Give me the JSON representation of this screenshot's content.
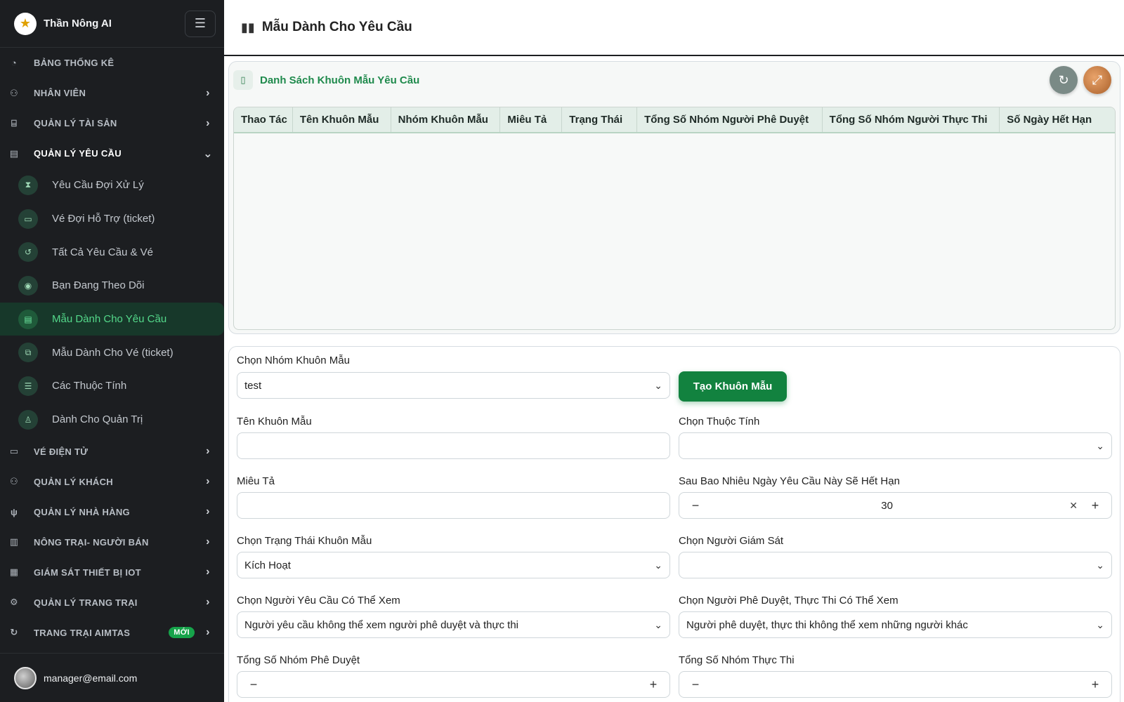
{
  "sidebar": {
    "brand_name": "Thần Nông AI",
    "items": [
      {
        "label": "BẢNG THỐNG KÊ",
        "icon": "dashboard-icon",
        "glyph": "◔"
      },
      {
        "label": "NHÂN VIÊN",
        "icon": "employees-icon",
        "glyph": "⚇"
      },
      {
        "label": "QUẢN LÝ TÀI SẢN",
        "icon": "assets-icon",
        "glyph": "⌸"
      },
      {
        "label": "QUẢN LÝ YÊU CẦU",
        "icon": "clipboard-icon",
        "glyph": "▤"
      },
      {
        "label": "VÉ ĐIỆN TỬ",
        "icon": "ticket-icon",
        "glyph": "▭"
      },
      {
        "label": "QUẢN LÝ KHÁCH",
        "icon": "guests-icon",
        "glyph": "⚇"
      },
      {
        "label": "QUẢN LÝ NHÀ HÀNG",
        "icon": "restaurant-icon",
        "glyph": "ψ"
      },
      {
        "label": "NÔNG TRẠI- NGƯỜI BÁN",
        "icon": "store-icon",
        "glyph": "▥"
      },
      {
        "label": "GIÁM SÁT THIẾT BỊ IOT",
        "icon": "iot-chart-icon",
        "glyph": "▦"
      },
      {
        "label": "QUẢN LÝ TRANG TRẠI",
        "icon": "farm-icon",
        "glyph": "⚙"
      },
      {
        "label": "TRANG TRẠI AIMTAS",
        "icon": "aimtas-icon",
        "glyph": "↻",
        "badge": "MỚI"
      }
    ],
    "sub_items": [
      {
        "label": "Yêu Cầu Đợi Xử Lý",
        "icon": "hourglass-icon",
        "glyph": "⧗"
      },
      {
        "label": "Vé Đợi Hỗ Trợ (ticket)",
        "icon": "ticket-icon",
        "glyph": "▭"
      },
      {
        "label": "Tất Cả Yêu Cầu & Vé",
        "icon": "history-icon",
        "glyph": "↺"
      },
      {
        "label": "Bạn Đang Theo Dõi",
        "icon": "eye-icon",
        "glyph": "◉"
      },
      {
        "label": "Mẫu Dành Cho Yêu Cầu",
        "icon": "document-icon",
        "glyph": "▤"
      },
      {
        "label": "Mẫu Dành Cho Vé (ticket)",
        "icon": "copy-icon",
        "glyph": "⧉"
      },
      {
        "label": "Các Thuộc Tính",
        "icon": "sliders-icon",
        "glyph": "☰"
      },
      {
        "label": "Dành Cho Quản Trị",
        "icon": "admin-icon",
        "glyph": "♙"
      }
    ],
    "user_email": "manager@email.com"
  },
  "header": {
    "title": "Mẫu Dành Cho Yêu Cầu"
  },
  "card": {
    "title": "Danh Sách Khuôn Mẫu Yêu Cầu",
    "columns": [
      "Thao Tác",
      "Tên Khuôn Mẫu",
      "Nhóm Khuôn Mẫu",
      "Miêu Tả",
      "Trạng Thái",
      "Tổng Số Nhóm Người Phê Duyệt",
      "Tổng Số Nhóm Người Thực Thi",
      "Số Ngày Hết Hạn"
    ]
  },
  "form": {
    "group_label": "Chọn Nhóm Khuôn Mẫu",
    "group_value": "test",
    "create_button": "Tạo Khuôn Mẫu",
    "name_label": "Tên Khuôn Mẫu",
    "name_value": "",
    "attr_label": "Chọn Thuộc Tính",
    "attr_value": "",
    "desc_label": "Miêu Tả",
    "desc_value": "",
    "expire_label": "Sau Bao Nhiêu Ngày Yêu Cầu Này Sẽ Hết Hạn",
    "expire_value": "30",
    "status_label": "Chọn Trạng Thái Khuôn Mẫu",
    "status_value": "Kích Hoạt",
    "supervisor_label": "Chọn Người Giám Sát",
    "supervisor_value": "",
    "requester_view_label": "Chọn Người Yêu Cầu Có Thể Xem",
    "requester_view_value": "Người yêu cầu không thể xem người phê duyệt và thực thi",
    "approver_view_label": "Chọn Người Phê Duyệt, Thực Thi Có Thể Xem",
    "approver_view_value": "Người phê duyệt, thực thi không thể xem những người khác",
    "approval_groups_label": "Tổng Số Nhóm Phê Duyệt",
    "approval_groups_value": "",
    "exec_groups_label": "Tổng Số Nhóm Thực Thi",
    "exec_groups_value": ""
  }
}
